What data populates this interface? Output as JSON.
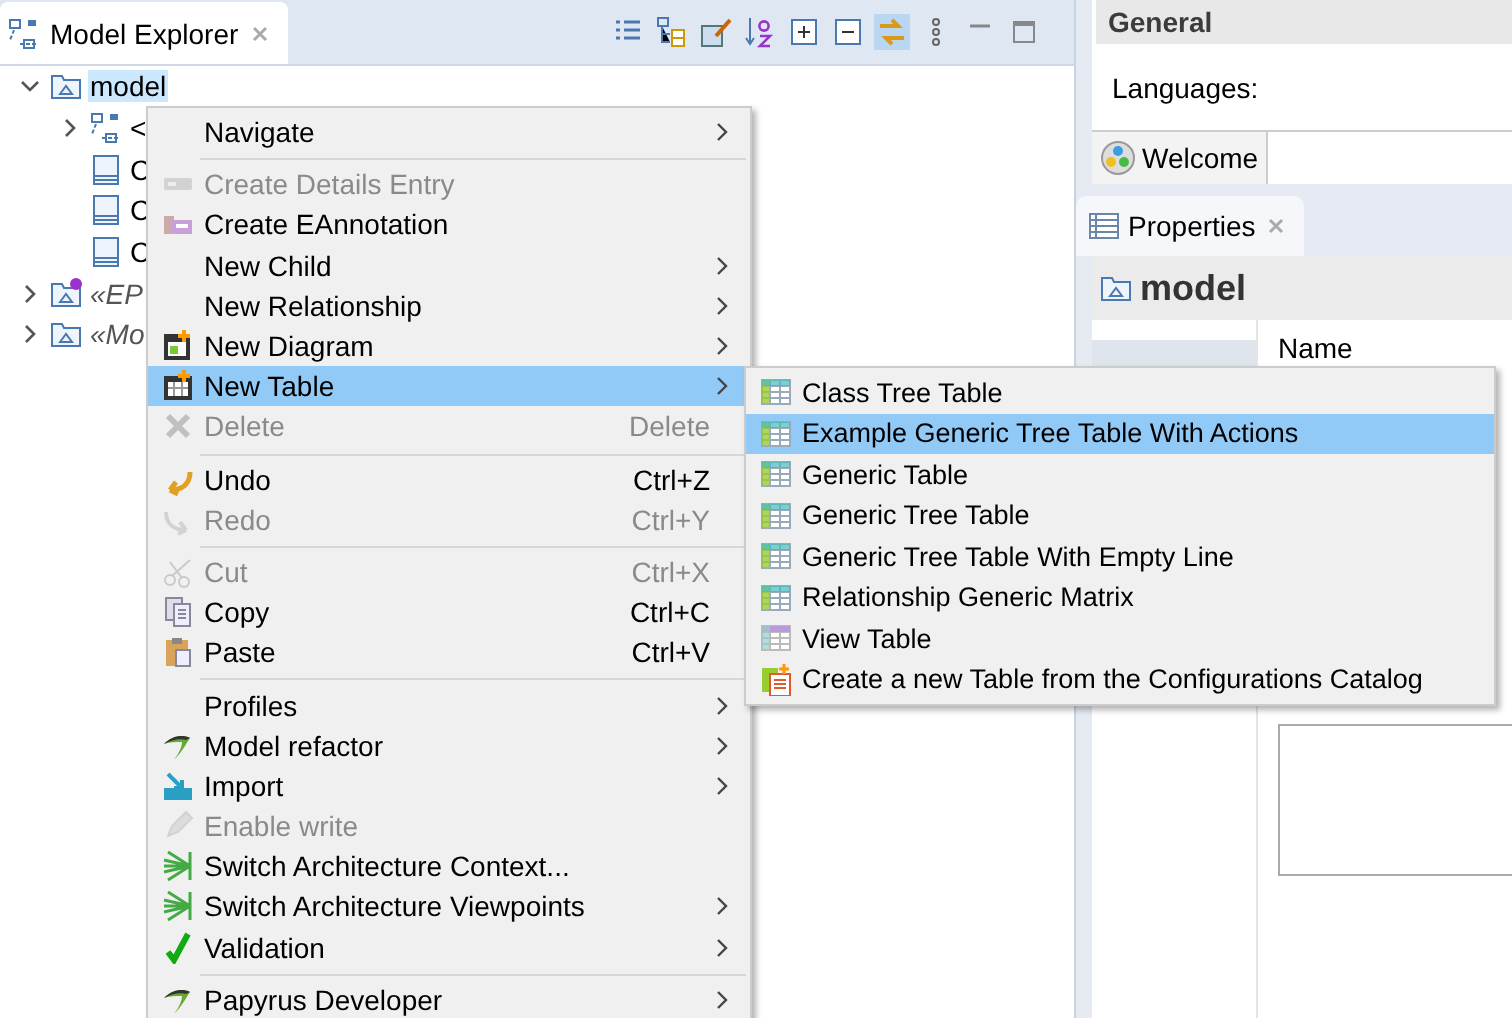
{
  "explorer": {
    "tab": {
      "title": "Model Explorer",
      "selected": true
    },
    "toolbar": {
      "toggle_on": true
    },
    "tree": [
      {
        "label": "model",
        "expanded": true,
        "selected": true,
        "stereotype": false,
        "children": [
          {
            "label": "<",
            "expanded": false,
            "selected": false,
            "stereotype": false
          },
          {
            "label": "C",
            "selected": false,
            "stereotype": false
          },
          {
            "label": "C",
            "selected": false,
            "stereotype": false
          },
          {
            "label": "C",
            "selected": false,
            "stereotype": false
          }
        ]
      },
      {
        "label": "«EP",
        "expanded": false,
        "selected": false,
        "stereotype": true
      },
      {
        "label": "«Mo",
        "expanded": false,
        "selected": false,
        "stereotype": true
      }
    ]
  },
  "properties_panel": {
    "section_title": "General",
    "languages_label": "Languages:",
    "editor_tabs": [
      {
        "label": "Welcome",
        "selected": true
      }
    ],
    "view_tabs": [
      {
        "label": "Properties",
        "selected": true
      }
    ],
    "element_title": "model",
    "field_label": "Name"
  },
  "context_menu": {
    "items": [
      {
        "kind": "item",
        "label": "Navigate",
        "submenu": true,
        "disabled": false,
        "selected": false
      },
      {
        "kind": "separator"
      },
      {
        "kind": "item",
        "label": "Create Details Entry",
        "submenu": false,
        "disabled": true,
        "selected": false
      },
      {
        "kind": "item",
        "label": "Create EAnnotation",
        "submenu": false,
        "disabled": false,
        "selected": false
      },
      {
        "kind": "item",
        "label": "New Child",
        "submenu": true,
        "disabled": false,
        "selected": false
      },
      {
        "kind": "item",
        "label": "New Relationship",
        "submenu": true,
        "disabled": false,
        "selected": false
      },
      {
        "kind": "item",
        "label": "New Diagram",
        "submenu": true,
        "disabled": false,
        "selected": false
      },
      {
        "kind": "item",
        "label": "New Table",
        "submenu": true,
        "disabled": false,
        "selected": true
      },
      {
        "kind": "item",
        "label": "Delete",
        "shortcut": "Delete",
        "submenu": false,
        "disabled": true,
        "selected": false
      },
      {
        "kind": "separator"
      },
      {
        "kind": "item",
        "label": "Undo",
        "shortcut": "Ctrl+Z",
        "submenu": false,
        "disabled": false,
        "selected": false
      },
      {
        "kind": "item",
        "label": "Redo",
        "shortcut": "Ctrl+Y",
        "submenu": false,
        "disabled": true,
        "selected": false
      },
      {
        "kind": "separator"
      },
      {
        "kind": "item",
        "label": "Cut",
        "shortcut": "Ctrl+X",
        "submenu": false,
        "disabled": true,
        "selected": false
      },
      {
        "kind": "item",
        "label": "Copy",
        "shortcut": "Ctrl+C",
        "submenu": false,
        "disabled": false,
        "selected": false
      },
      {
        "kind": "item",
        "label": "Paste",
        "shortcut": "Ctrl+V",
        "submenu": false,
        "disabled": false,
        "selected": false
      },
      {
        "kind": "separator"
      },
      {
        "kind": "item",
        "label": "Profiles",
        "submenu": true,
        "disabled": false,
        "selected": false
      },
      {
        "kind": "item",
        "label": "Model refactor",
        "submenu": true,
        "disabled": false,
        "selected": false
      },
      {
        "kind": "item",
        "label": "Import",
        "submenu": true,
        "disabled": false,
        "selected": false
      },
      {
        "kind": "item",
        "label": "Enable write",
        "submenu": false,
        "disabled": true,
        "selected": false
      },
      {
        "kind": "item",
        "label": "Switch Architecture Context...",
        "submenu": false,
        "disabled": false,
        "selected": false
      },
      {
        "kind": "item",
        "label": "Switch Architecture Viewpoints",
        "submenu": true,
        "disabled": false,
        "selected": false
      },
      {
        "kind": "item",
        "label": "Validation",
        "submenu": true,
        "disabled": false,
        "selected": false
      },
      {
        "kind": "separator"
      },
      {
        "kind": "item",
        "label": "Papyrus Developer",
        "submenu": true,
        "disabled": false,
        "selected": false
      }
    ]
  },
  "submenu": {
    "items": [
      {
        "kind": "item",
        "label": "Class Tree Table",
        "submenu": false,
        "disabled": false,
        "selected": false
      },
      {
        "kind": "item",
        "label": "Example Generic Tree Table With Actions",
        "submenu": false,
        "disabled": false,
        "selected": true
      },
      {
        "kind": "item",
        "label": "Generic Table",
        "submenu": false,
        "disabled": false,
        "selected": false
      },
      {
        "kind": "item",
        "label": "Generic Tree Table",
        "submenu": false,
        "disabled": false,
        "selected": false
      },
      {
        "kind": "item",
        "label": "Generic Tree Table With Empty Line",
        "submenu": false,
        "disabled": false,
        "selected": false
      },
      {
        "kind": "item",
        "label": "Relationship Generic Matrix",
        "submenu": false,
        "disabled": false,
        "selected": false
      },
      {
        "kind": "item",
        "label": "View Table",
        "submenu": false,
        "disabled": false,
        "selected": false
      },
      {
        "kind": "item",
        "label": "Create a new Table from the Configurations Catalog",
        "submenu": false,
        "disabled": false,
        "selected": false
      }
    ]
  }
}
